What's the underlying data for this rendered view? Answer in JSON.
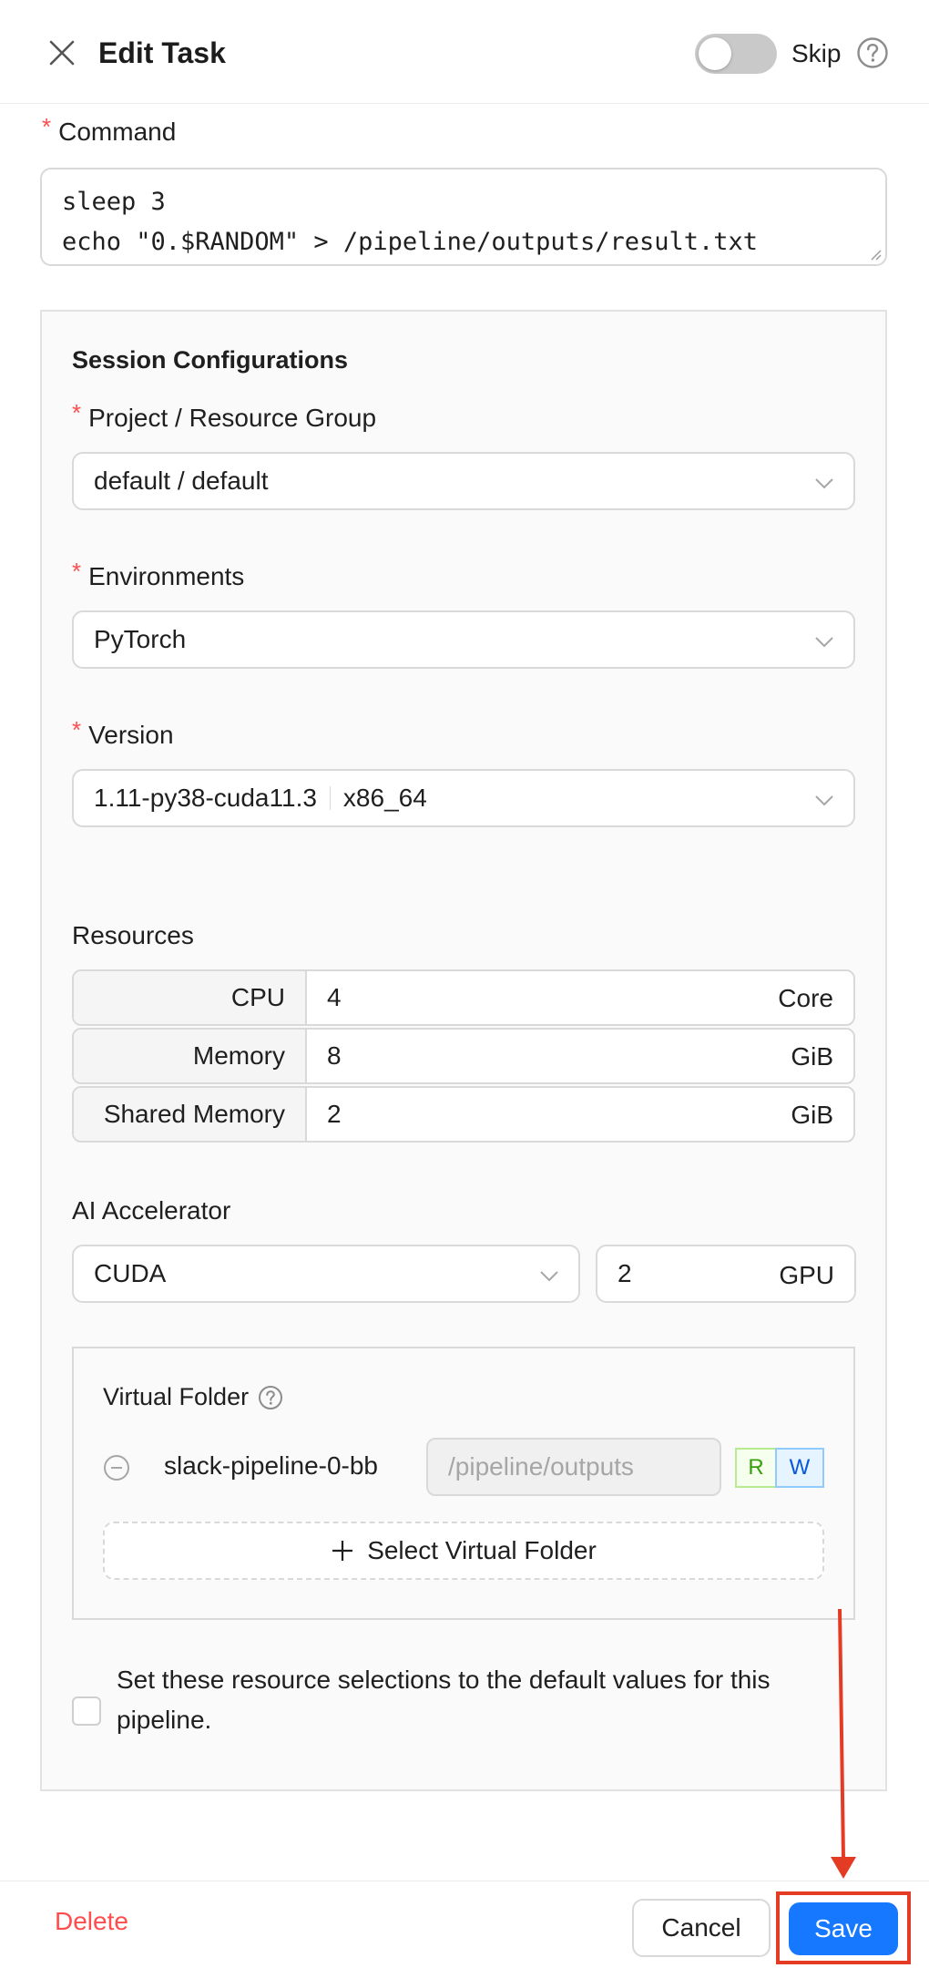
{
  "header": {
    "title": "Edit Task",
    "skip_label": "Skip",
    "skip_enabled": false
  },
  "command": {
    "label": "Command",
    "lines": [
      "sleep 3",
      "echo \"0.$RANDOM\" > /pipeline/outputs/result.txt"
    ]
  },
  "session": {
    "title": "Session Configurations",
    "project": {
      "label": "Project / Resource Group",
      "value": "default / default"
    },
    "environment": {
      "label": "Environments",
      "value": "PyTorch"
    },
    "version": {
      "label": "Version",
      "value": "1.11-py38-cuda11.3",
      "arch": "x86_64"
    },
    "resources": {
      "label": "Resources",
      "rows": [
        {
          "name": "CPU",
          "value": "4",
          "unit": "Core"
        },
        {
          "name": "Memory",
          "value": "8",
          "unit": "GiB"
        },
        {
          "name": "Shared Memory",
          "value": "2",
          "unit": "GiB"
        }
      ]
    },
    "accelerator": {
      "label": "AI Accelerator",
      "type": "CUDA",
      "count": "2",
      "unit": "GPU"
    },
    "virtual_folder": {
      "label": "Virtual Folder",
      "name": "slack-pipeline-0-bb",
      "path_placeholder": "/pipeline/outputs",
      "read_label": "R",
      "write_label": "W",
      "select_label": "Select Virtual Folder"
    },
    "default_checkbox": {
      "label": "Set these resource selections to the default values for this pipeline.",
      "checked": false
    }
  },
  "footer": {
    "delete_label": "Delete",
    "cancel_label": "Cancel",
    "save_label": "Save"
  },
  "colors": {
    "primary": "#1677ff",
    "danger": "#ff4d4f",
    "annotation": "#e43b24"
  }
}
